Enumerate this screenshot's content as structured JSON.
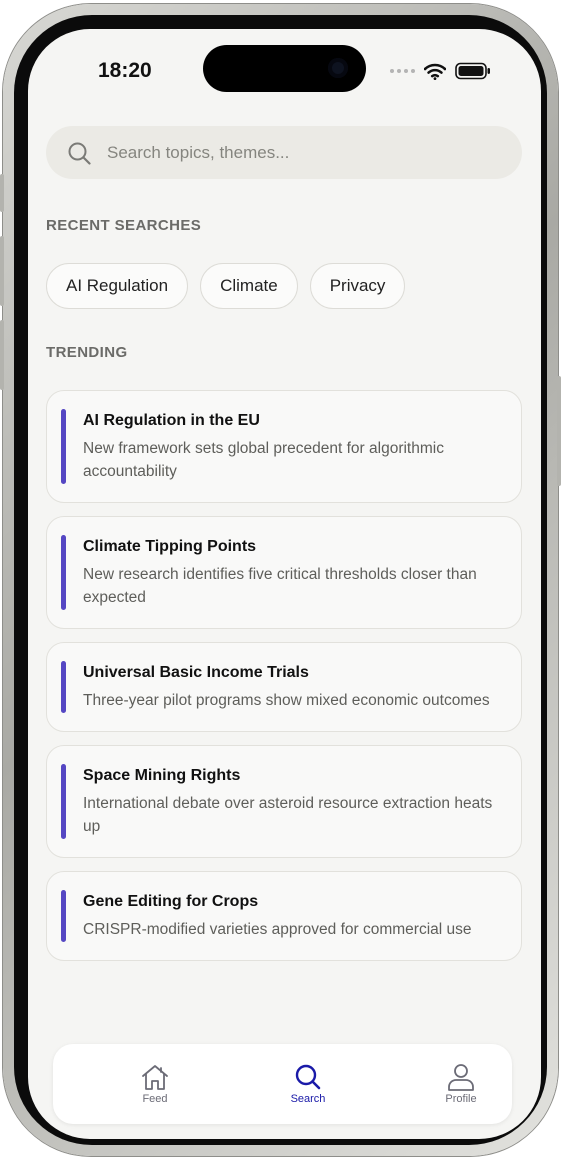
{
  "status": {
    "time": "18:20"
  },
  "search": {
    "placeholder": "Search topics, themes...",
    "value": ""
  },
  "recent": {
    "title": "RECENT SEARCHES",
    "items": [
      "AI Regulation",
      "Climate",
      "Privacy"
    ]
  },
  "trending": {
    "title": "TRENDING",
    "items": [
      {
        "title": "AI Regulation in the EU",
        "description": "New framework sets global precedent for algorithmic accountability"
      },
      {
        "title": "Climate Tipping Points",
        "description": "New research identifies five critical thresholds closer than expected"
      },
      {
        "title": "Universal Basic Income Trials",
        "description": "Three-year pilot programs show mixed economic outcomes"
      },
      {
        "title": "Space Mining Rights",
        "description": "International debate over asteroid resource extraction heats up"
      },
      {
        "title": "Gene Editing for Crops",
        "description": "CRISPR-modified varieties approved for commercial use"
      }
    ]
  },
  "tabs": [
    {
      "label": "Feed",
      "icon": "home-icon",
      "active": false
    },
    {
      "label": "Search",
      "icon": "search-icon",
      "active": true
    },
    {
      "label": "Profile",
      "icon": "person-icon",
      "active": false
    }
  ],
  "colors": {
    "accent": "#5547c3",
    "active_tab": "#1a1aa8",
    "background": "#f5f5f3"
  }
}
